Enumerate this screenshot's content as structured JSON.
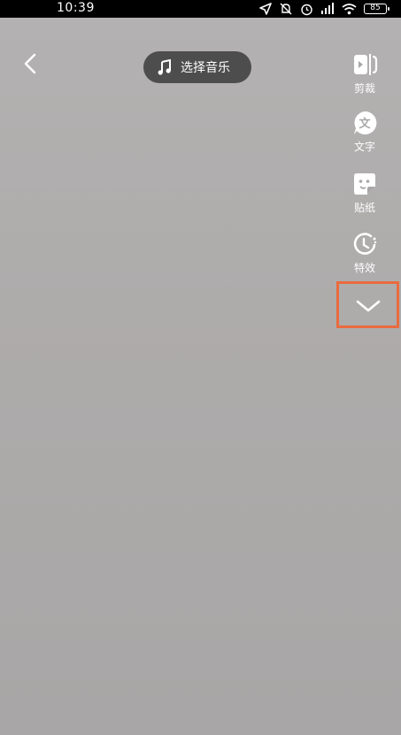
{
  "status_bar": {
    "time": "10:39",
    "battery": "85"
  },
  "top_bar": {
    "music_label": "选择音乐"
  },
  "tools": [
    {
      "id": "trim",
      "label": "剪裁",
      "icon": "trim-icon"
    },
    {
      "id": "text",
      "label": "文字",
      "icon": "text-icon"
    },
    {
      "id": "sticker",
      "label": "贴纸",
      "icon": "sticker-icon"
    },
    {
      "id": "effects",
      "label": "特效",
      "icon": "effects-icon"
    }
  ],
  "colors": {
    "highlight_border": "#e96b3f",
    "pill_background": "#3c3c3c",
    "video_background": "#aeabab"
  }
}
